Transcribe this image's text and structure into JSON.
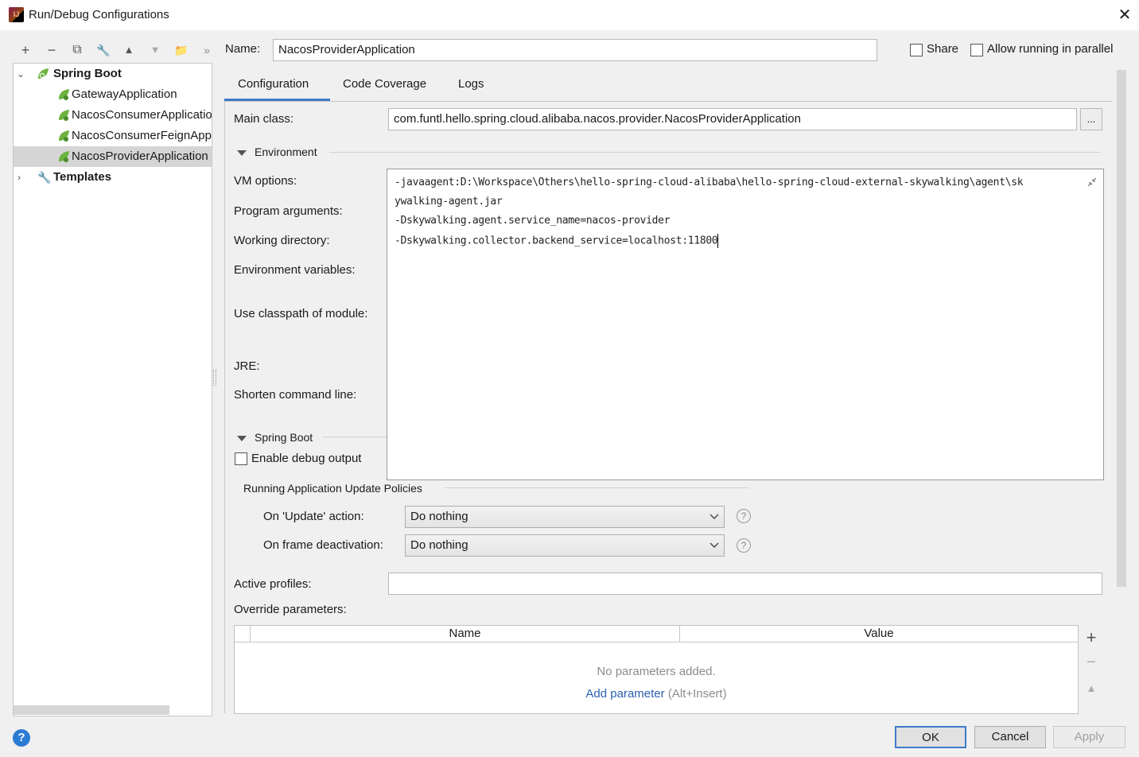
{
  "window": {
    "title": "Run/Debug Configurations",
    "app_icon": "intellij-icon",
    "close_glyph": "✕"
  },
  "toolbar": {
    "icons": [
      "add-icon",
      "remove-icon",
      "copy-icon",
      "wrench-icon",
      "move-up-icon",
      "move-down-icon",
      "folder-icon",
      "more-icon"
    ],
    "glyphs": [
      "+",
      "−",
      "⧉",
      "🔧",
      "▲",
      "▼",
      "📁",
      "»"
    ]
  },
  "tree": {
    "root_label": "Spring Boot",
    "items": [
      {
        "label": "GatewayApplication",
        "selected": false
      },
      {
        "label": "NacosConsumerApplication",
        "selected": false
      },
      {
        "label": "NacosConsumerFeignApplication",
        "selected": false
      },
      {
        "label": "NacosProviderApplication",
        "selected": true
      }
    ],
    "templates_label": "Templates"
  },
  "header": {
    "name_label": "Name:",
    "name_value": "NacosProviderApplication",
    "share_label": "Share",
    "share_checked": false,
    "parallel_label": "Allow running in parallel",
    "parallel_checked": false
  },
  "tabs": [
    {
      "label": "Configuration",
      "active": true
    },
    {
      "label": "Code Coverage",
      "active": false
    },
    {
      "label": "Logs",
      "active": false
    }
  ],
  "form": {
    "main_class_label": "Main class:",
    "main_class_value": "com.funtl.hello.spring.cloud.alibaba.nacos.provider.NacosProviderApplication",
    "browse_label": "...",
    "environment_section": "Environment",
    "vm_options_label": "VM options:",
    "program_args_label": "Program arguments:",
    "working_dir_label": "Working directory:",
    "env_vars_label": "Environment variables:",
    "classpath_label": "Use classpath of module:",
    "jre_label": "JRE:",
    "shorten_label": "Shorten command line:",
    "spring_boot_section": "Spring Boot",
    "debug_output_label": "Enable debug output",
    "debug_output_checked": false,
    "update_policies_section": "Running Application Update Policies",
    "update_action_label": "On 'Update' action:",
    "update_action_value": "Do nothing",
    "frame_deactivation_label": "On frame deactivation:",
    "frame_deactivation_value": "Do nothing",
    "help_glyph": "?",
    "active_profiles_label": "Active profiles:",
    "active_profiles_value": "",
    "override_params_label": "Override parameters:"
  },
  "vm_editor": {
    "lines": [
      "-javaagent:D:\\Workspace\\Others\\hello-spring-cloud-alibaba\\hello-spring-cloud-external-skywalking\\agent\\sk",
      "ywalking-agent.jar",
      "-Dskywalking.agent.service_name=nacos-provider",
      "-Dskywalking.collector.backend_service=localhost:11800"
    ],
    "collapse_icon": "collapse-icon"
  },
  "params_table": {
    "columns": [
      "Name",
      "Value"
    ],
    "empty_text": "No parameters added.",
    "add_link": "Add parameter",
    "add_shortcut": "(Alt+Insert)",
    "side_glyphs": [
      "+",
      "−",
      "▲"
    ]
  },
  "footer": {
    "help_glyph": "?",
    "ok_label": "OK",
    "cancel_label": "Cancel",
    "apply_label": "Apply"
  },
  "colors": {
    "accent": "#3d7cc9",
    "link": "#2a5fad",
    "spring_green": "#6db33f"
  }
}
